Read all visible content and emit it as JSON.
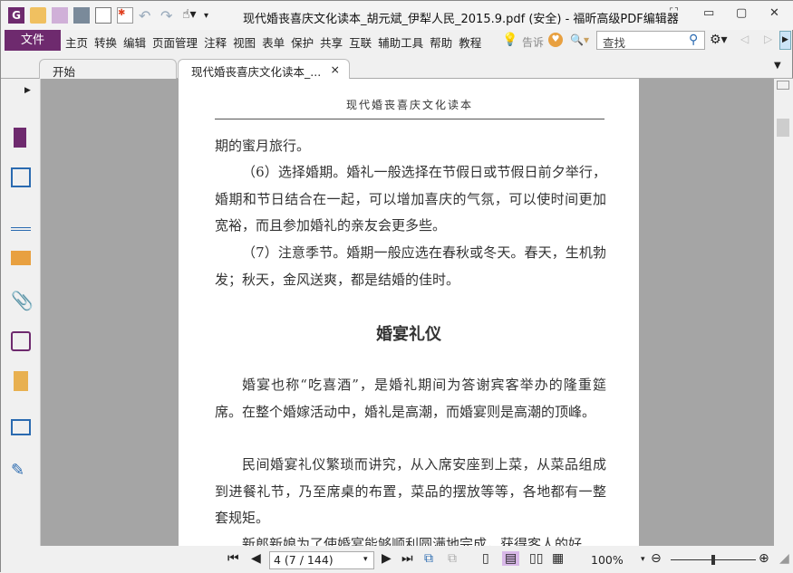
{
  "window": {
    "title": "现代婚丧喜庆文化读本_胡元斌_伊犁人民_2015.9.pdf (安全) - 福昕高级PDF编辑器"
  },
  "menu": {
    "file": "文件",
    "items": [
      "主页",
      "转换",
      "编辑",
      "页面管理",
      "注释",
      "视图",
      "表单",
      "保护",
      "共享",
      "互联",
      "辅助工具",
      "帮助",
      "教程"
    ],
    "tell": "告诉",
    "search_placeholder": "查找"
  },
  "tabs": [
    {
      "label": "开始"
    },
    {
      "label": "现代婚丧喜庆文化读本_...",
      "close": "×"
    }
  ],
  "page": {
    "header": "现代婚丧喜庆文化读本",
    "paragraphs": [
      "期的蜜月旅行。",
      "（6）选择婚期。婚礼一般选择在节假日或节假日前夕举行，婚期和节日结合在一起，可以增加喜庆的气氛，可以使时间更加宽裕，而且参加婚礼的亲友会更多些。",
      "（7）注意季节。婚期一般应选在春秋或冬天。春天，生机勃发；秋天，金风送爽，都是结婚的佳时。"
    ],
    "heading": "婚宴礼仪",
    "paragraphs2": [
      "婚宴也称“吃喜酒”，是婚礼期间为答谢宾客举办的隆重筵席。在整个婚嫁活动中，婚礼是高潮，而婚宴则是高潮的顶峰。",
      "民间婚宴礼仪繁琐而讲究，从入席安座到上菜，从菜品组成到进餐礼节，乃至席桌的布置，菜品的摆放等等，各地都有一整套规矩。",
      "新郎新娘为了使婚宴能够顺利圆满地完成，获得客人的好"
    ]
  },
  "status": {
    "page_field": "4 (7 / 144)",
    "zoom": "100%",
    "zoom_slider_percent": 50
  }
}
